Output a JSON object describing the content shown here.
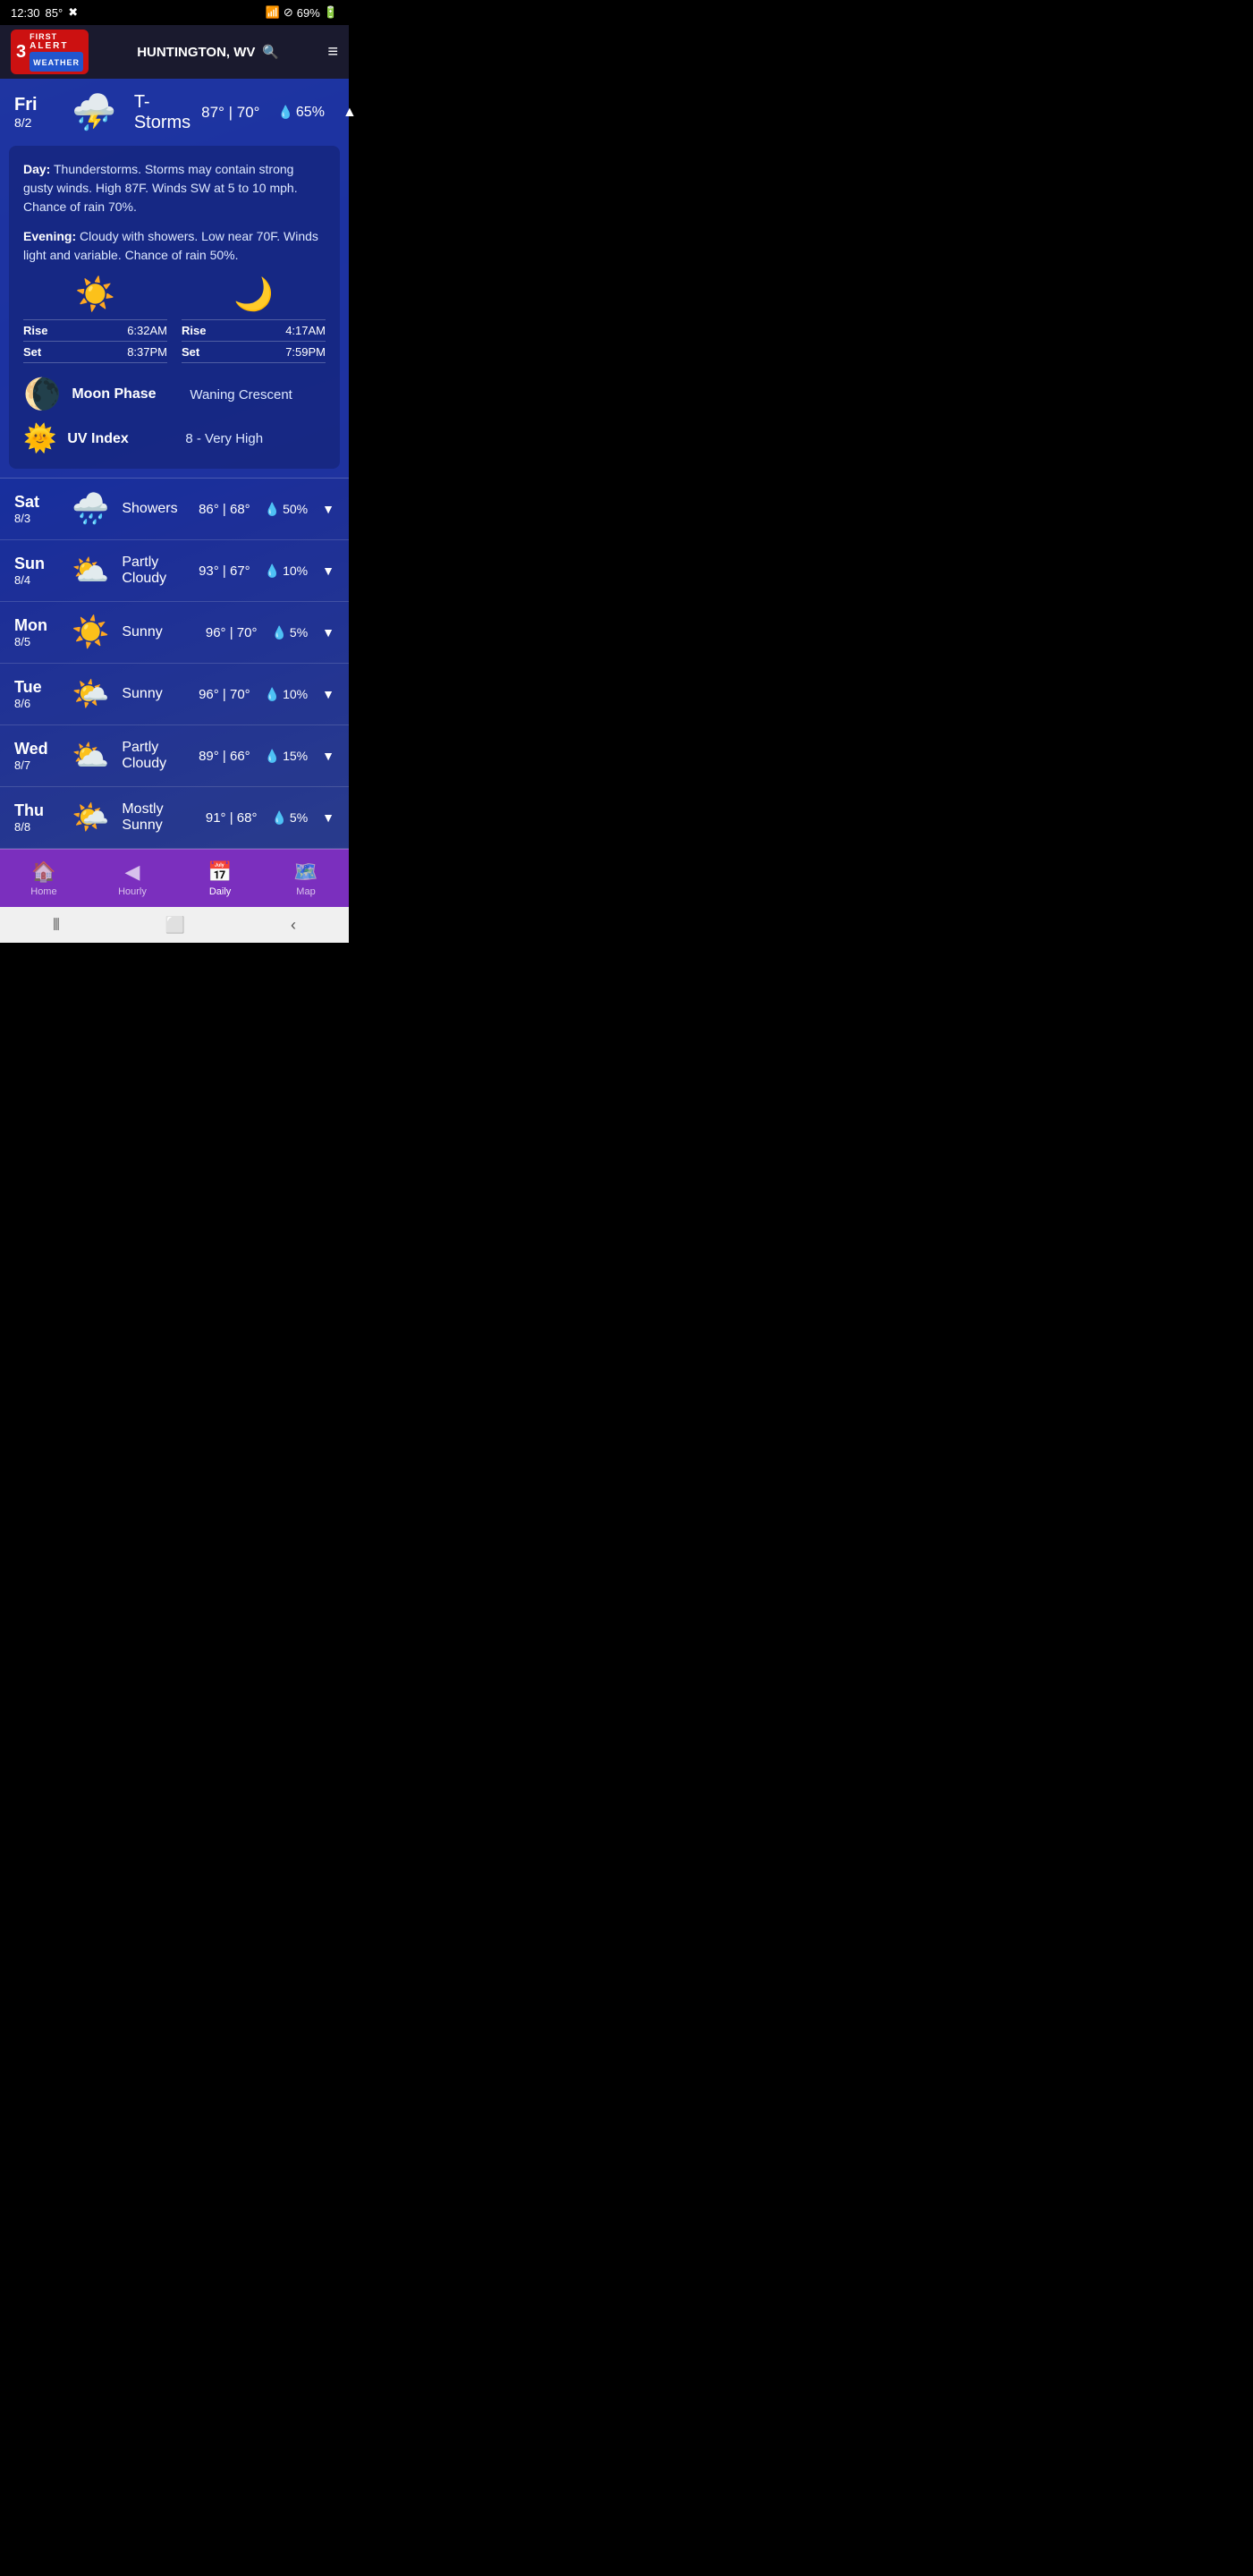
{
  "statusBar": {
    "time": "12:30",
    "temp": "85°",
    "battery": "69%",
    "wifi": true,
    "doNotDisturb": true
  },
  "header": {
    "logoNumber": "3",
    "logoFirst": "FIRST",
    "logoAlert": "ALERT",
    "logoWeather": "WEATHER",
    "location": "HUNTINGTON, WV",
    "searchIcon": "🔍",
    "menuIcon": "≡"
  },
  "currentDay": {
    "dayName": "Fri",
    "dayDate": "8/2",
    "icon": "⛈️",
    "condition": "T-Storms",
    "high": "87°",
    "low": "70°",
    "precipPercent": "65%",
    "expanded": true,
    "chevron": "▲",
    "dayForecast": "Thunderstorms. Storms may contain strong gusty winds. High 87F. Winds SW at 5 to 10 mph. Chance of rain 70%.",
    "eveningForecast": "Cloudy with showers. Low near 70F. Winds light and variable. Chance of rain 50%.",
    "sunRise": "6:32AM",
    "sunSet": "8:37PM",
    "moonRise": "4:17AM",
    "moonSet": "7:59PM",
    "moonPhase": "Waning Crescent",
    "uvIndex": "8 - Very High"
  },
  "forecast": [
    {
      "dayName": "Sat",
      "dayDate": "8/3",
      "icon": "🌧️",
      "condition": "Showers",
      "high": "86°",
      "low": "68°",
      "precipPercent": "50%"
    },
    {
      "dayName": "Sun",
      "dayDate": "8/4",
      "icon": "⛅",
      "condition": "Partly\nCloudy",
      "high": "93°",
      "low": "67°",
      "precipPercent": "10%"
    },
    {
      "dayName": "Mon",
      "dayDate": "8/5",
      "icon": "☀️",
      "condition": "Sunny",
      "high": "96°",
      "low": "70°",
      "precipPercent": "5%"
    },
    {
      "dayName": "Tue",
      "dayDate": "8/6",
      "icon": "🌤️",
      "condition": "Sunny",
      "high": "96°",
      "low": "70°",
      "precipPercent": "10%"
    },
    {
      "dayName": "Wed",
      "dayDate": "8/7",
      "icon": "⛅",
      "condition": "Partly\nCloudy",
      "high": "89°",
      "low": "66°",
      "precipPercent": "15%"
    },
    {
      "dayName": "Thu",
      "dayDate": "8/8",
      "icon": "🌤️",
      "condition": "Mostly\nSunny",
      "high": "91°",
      "low": "68°",
      "precipPercent": "5%"
    }
  ],
  "bottomNav": {
    "items": [
      {
        "label": "Home",
        "icon": "🏠",
        "active": false
      },
      {
        "label": "Hourly",
        "icon": "◀",
        "active": false
      },
      {
        "label": "Daily",
        "icon": "📅",
        "active": true
      },
      {
        "label": "Map",
        "icon": "🗺️",
        "active": false
      }
    ]
  }
}
